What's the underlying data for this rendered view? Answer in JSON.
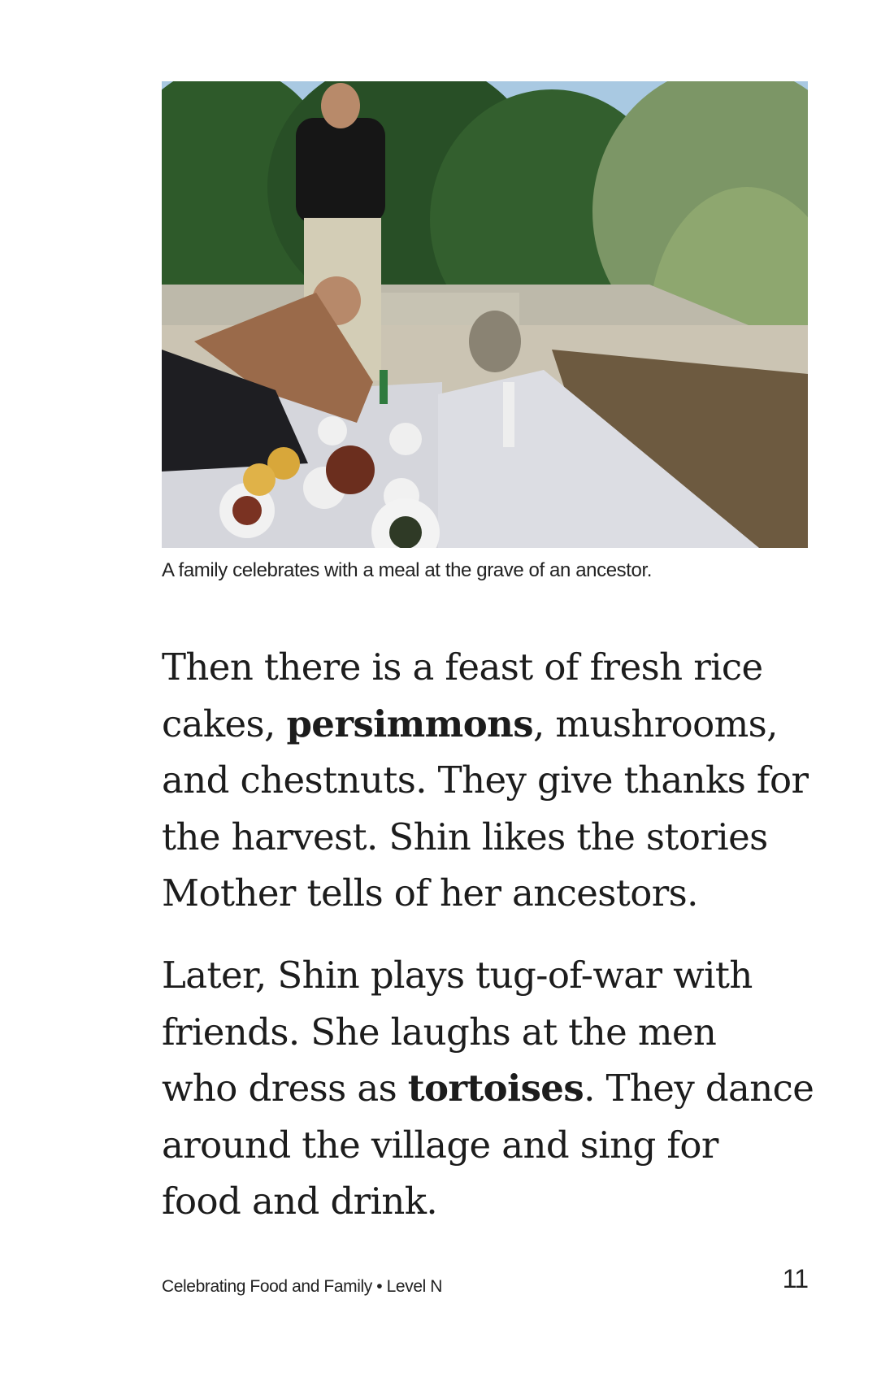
{
  "photo": {
    "subject": "family-meal-at-grave",
    "palette": {
      "sky": "#9fc3e0",
      "trees": "#2f5a2c",
      "cloth": "#d9dbe3",
      "ground": "#7a6448"
    }
  },
  "caption": "A family celebrates with a meal at the grave of an ancestor.",
  "paragraph1": {
    "lines": [
      [
        "Then there is a feast of fresh rice"
      ],
      [
        "cakes, ",
        "persimmons",
        ", mushrooms,"
      ],
      [
        "and chestnuts. They give thanks for"
      ],
      [
        "the harvest. Shin likes the stories"
      ],
      [
        "Mother tells of her ancestors."
      ]
    ]
  },
  "paragraph2": {
    "lines": [
      [
        "Later, Shin plays tug-of-war with"
      ],
      [
        "friends. She laughs at the men"
      ],
      [
        "who dress as ",
        "tortoises",
        ". They dance"
      ],
      [
        "around the village and sing for"
      ],
      [
        "food and drink."
      ]
    ]
  },
  "footer": {
    "book_title": "Celebrating Food and Family • Level N",
    "page_number": "11"
  }
}
